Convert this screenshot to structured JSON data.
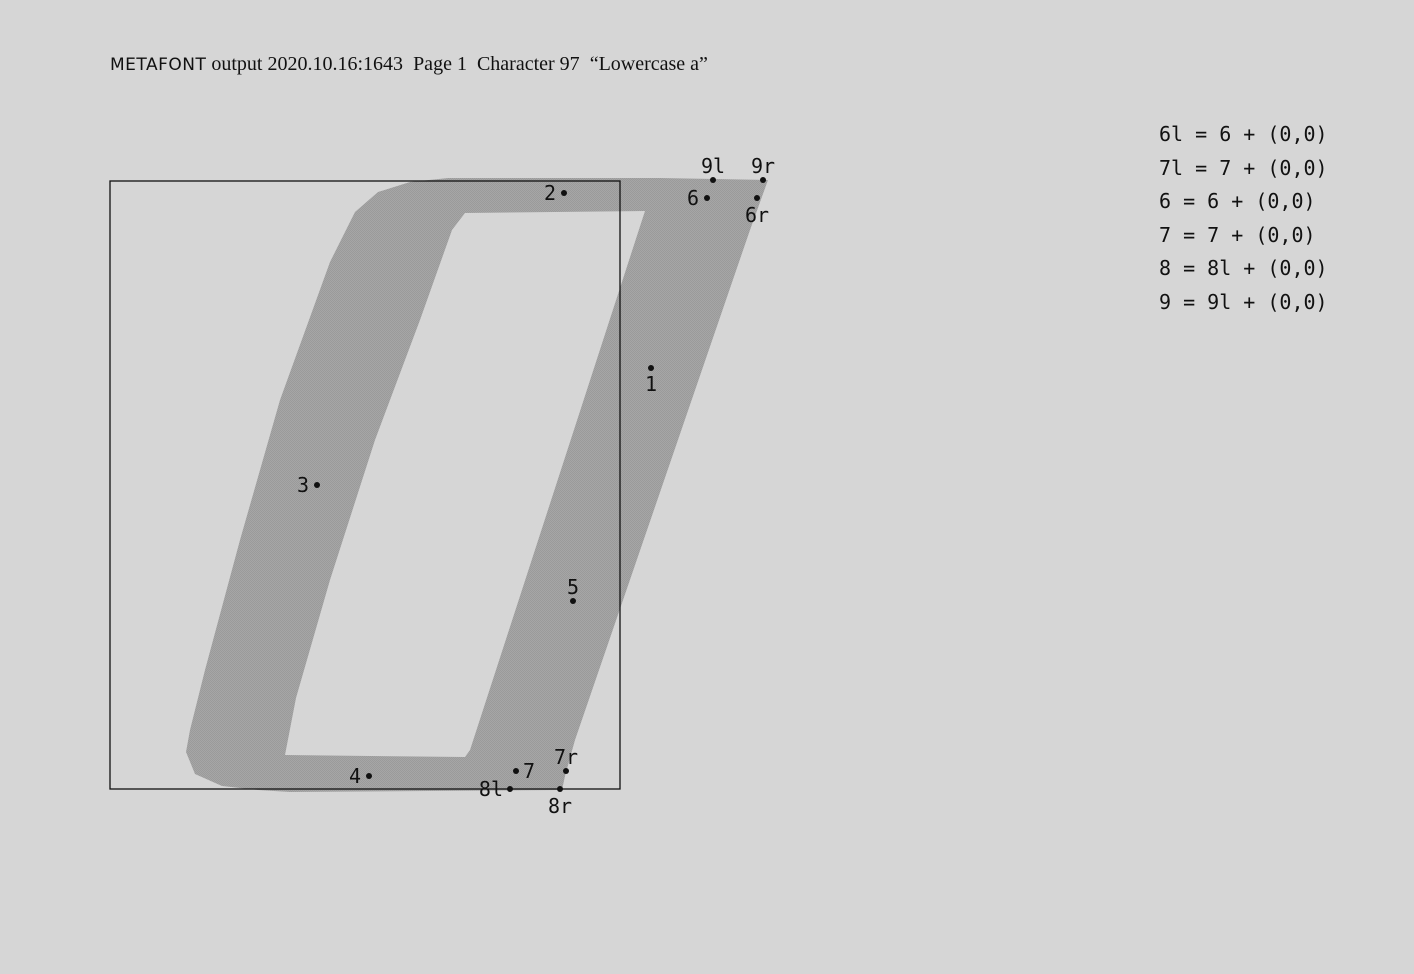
{
  "header": {
    "program": "METAFONT",
    "output_label": "output",
    "timestamp": "2020.10.16:1643",
    "page": "Page 1",
    "character": "Character 97",
    "character_name": "“Lowercase a”"
  },
  "equations": [
    "6l = 6 + (0,0)",
    "7l = 7 + (0,0)",
    "6 = 6 + (0,0)",
    "7 = 7 + (0,0)",
    "8 = 8l + (0,0)",
    "9 = 9l + (0,0)"
  ],
  "points": [
    {
      "id": "1",
      "label": "1"
    },
    {
      "id": "2",
      "label": "2"
    },
    {
      "id": "3",
      "label": "3"
    },
    {
      "id": "4",
      "label": "4"
    },
    {
      "id": "5",
      "label": "5"
    },
    {
      "id": "6",
      "label": "6"
    },
    {
      "id": "6r",
      "label": "6r"
    },
    {
      "id": "7",
      "label": "7"
    },
    {
      "id": "7r",
      "label": "7r"
    },
    {
      "id": "8l",
      "label": "8l"
    },
    {
      "id": "8r",
      "label": "8r"
    },
    {
      "id": "9l",
      "label": "9l"
    },
    {
      "id": "9r",
      "label": "9r"
    }
  ],
  "colors": {
    "background": "#d6d6d6",
    "glyph_fill": "#a3a3a3",
    "ink": "#111111"
  }
}
